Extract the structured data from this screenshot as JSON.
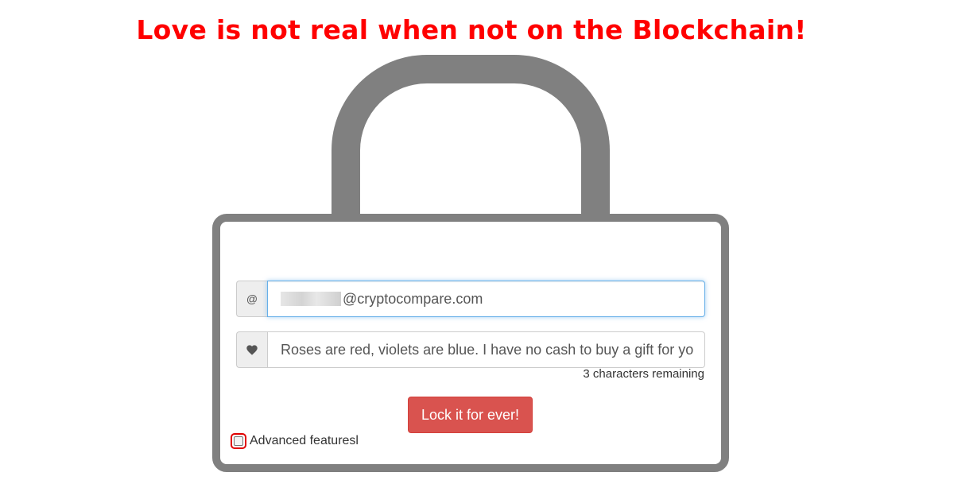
{
  "header": {
    "headline": "Love is not real when not on the Blockchain!"
  },
  "form": {
    "email": {
      "addon_symbol": "@",
      "value_visible": "@cryptocompare.com"
    },
    "message": {
      "addon_icon": "heart-icon",
      "value": "Roses are red, violets are blue. I have no cash to buy a gift for yo"
    },
    "characters_remaining": "3 characters remaining",
    "submit_label": "Lock it for ever!",
    "advanced_label": "Advanced featuresl",
    "advanced_checked": false
  },
  "colors": {
    "headline": "#ff0000",
    "lock": "#808080",
    "button": "#d9534f",
    "focus": "#66afe9"
  }
}
